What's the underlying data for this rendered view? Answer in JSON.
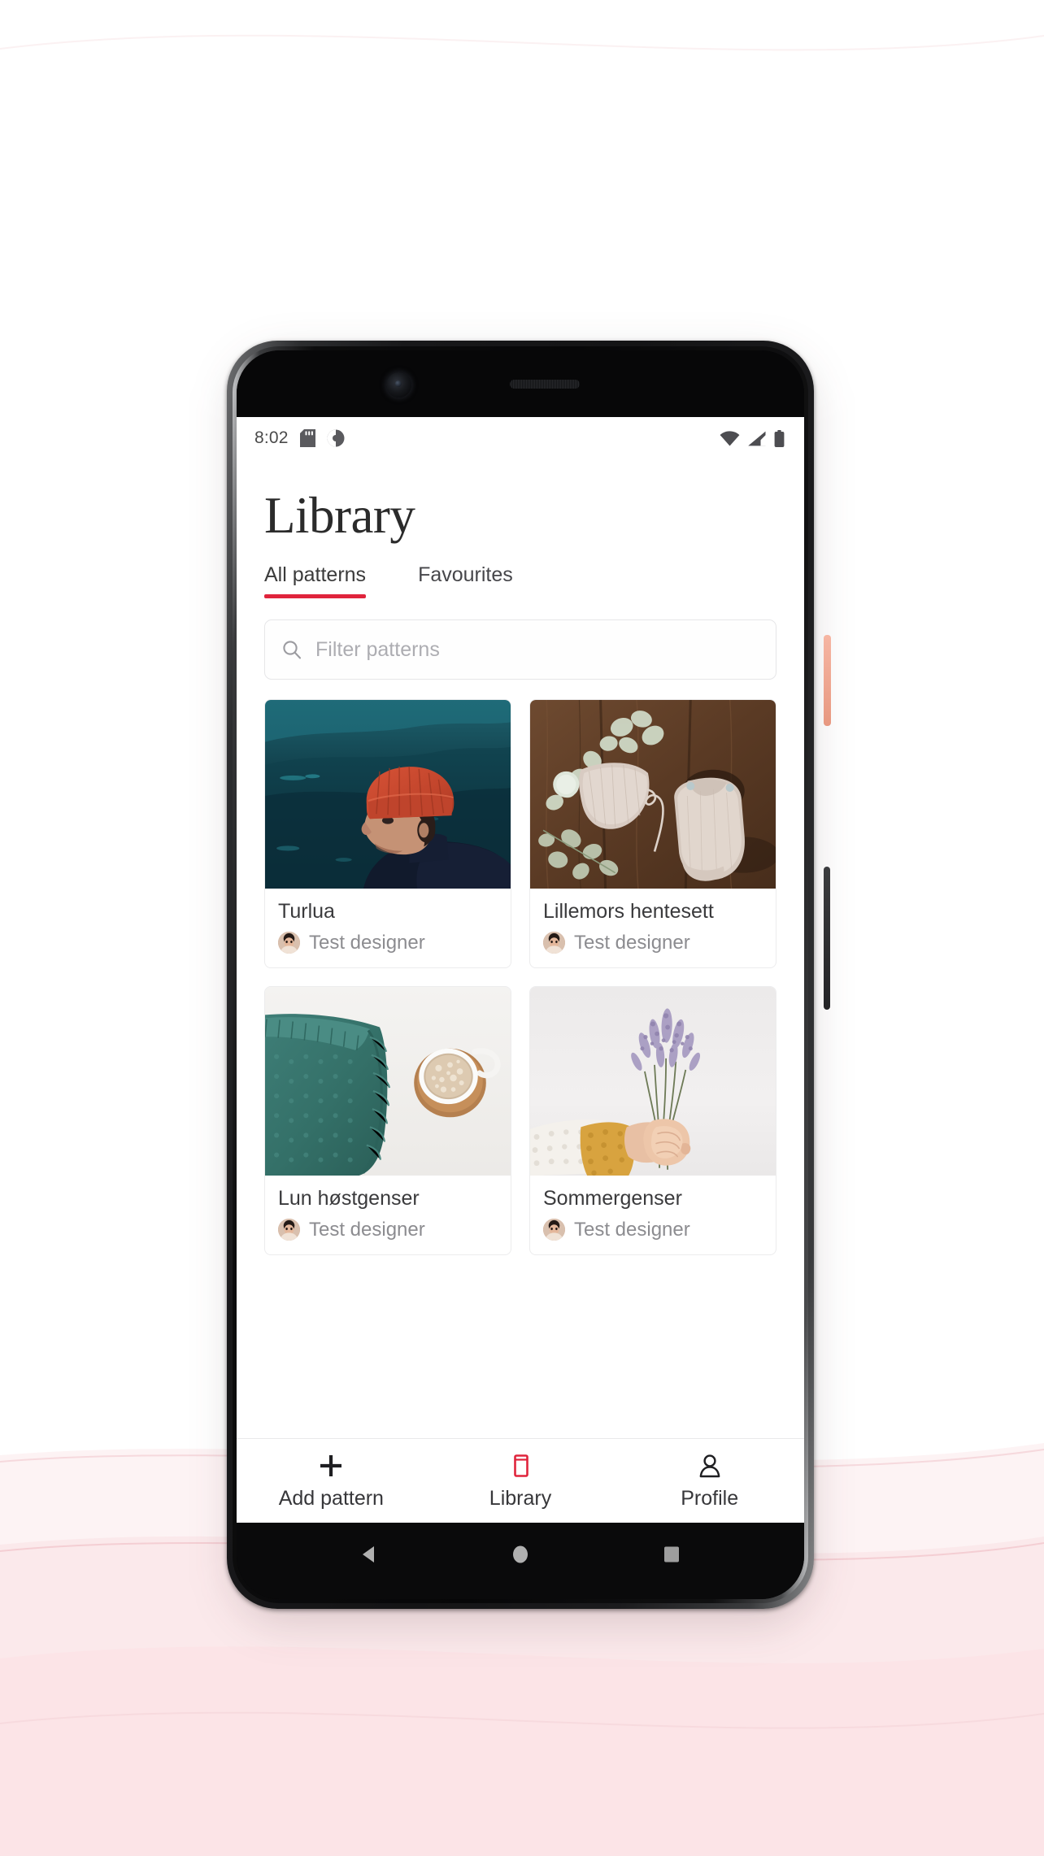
{
  "statusbar": {
    "time": "8:02",
    "icons_left": [
      "sd-card-icon",
      "do-not-disturb-icon"
    ],
    "icons_right": [
      "wifi-icon",
      "cellular-signal-icon",
      "battery-icon"
    ]
  },
  "header": {
    "title": "Library"
  },
  "tabs": [
    {
      "label": "All patterns",
      "active": true
    },
    {
      "label": "Favourites",
      "active": false
    }
  ],
  "search": {
    "placeholder": "Filter patterns",
    "value": "",
    "icon": "search-icon"
  },
  "patterns": [
    {
      "title": "Turlua",
      "author": "Test designer",
      "image": "person-red-beanie-mountain-photo"
    },
    {
      "title": "Lillemors hentesett",
      "author": "Test designer",
      "image": "knitted-baby-set-on-wood-photo"
    },
    {
      "title": "Lun høstgenser",
      "author": "Test designer",
      "image": "teal-knit-sweater-coffee-photo"
    },
    {
      "title": "Sommergenser",
      "author": "Test designer",
      "image": "hand-holding-lavender-photo"
    }
  ],
  "bottom_nav": [
    {
      "label": "Add pattern",
      "icon": "plus-icon",
      "active": false
    },
    {
      "label": "Library",
      "icon": "book-icon",
      "active": true
    },
    {
      "label": "Profile",
      "icon": "person-icon",
      "active": false
    }
  ],
  "system_nav": [
    {
      "name": "back-button",
      "icon": "triangle-back-icon"
    },
    {
      "name": "home-button",
      "icon": "circle-home-icon"
    },
    {
      "name": "recents-button",
      "icon": "square-recents-icon"
    }
  ],
  "colors": {
    "accent_red": "#e0243c",
    "text_primary": "#3a3a3c",
    "text_secondary": "#8c8c90",
    "background": "#ffffff",
    "page_tint": "#fdf0f1",
    "power_button": "#f0a58e"
  }
}
